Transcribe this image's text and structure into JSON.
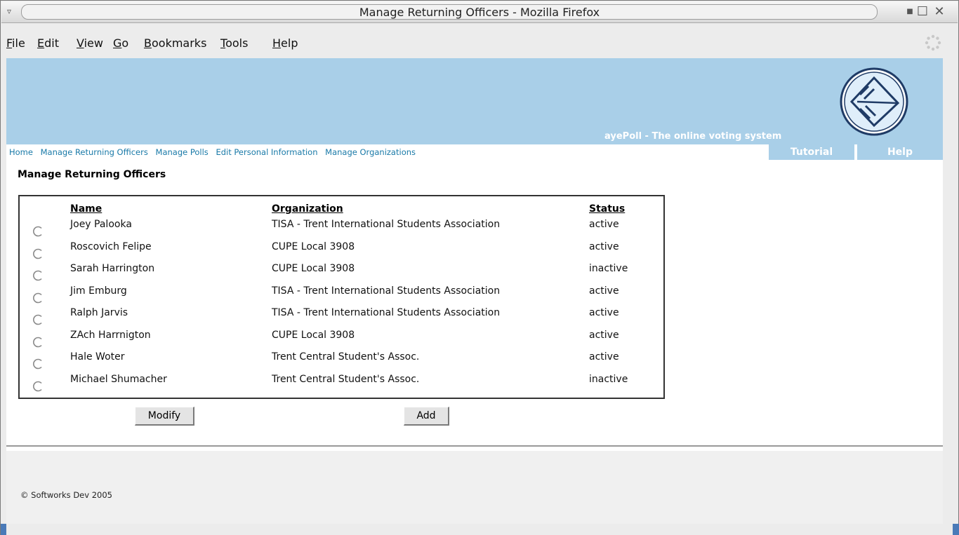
{
  "window": {
    "title": "Manage Returning Officers - Mozilla Firefox",
    "menu_glyph": "▿",
    "minimize_glyph": "■",
    "maximize_glyph": "☐",
    "close_glyph": "✕"
  },
  "menubar": {
    "items": [
      "File",
      "Edit",
      "View",
      "Go",
      "Bookmarks",
      "Tools",
      "Help"
    ]
  },
  "banner": {
    "tagline": "ayePoll - The online voting system",
    "logo_icon": "cupe-scfp-logo"
  },
  "nav": {
    "links": [
      "Home",
      "Manage Returning Officers",
      "Manage Polls",
      "Edit Personal Information",
      "Manage Organizations"
    ],
    "tabs": [
      "Tutorial",
      "Help"
    ]
  },
  "page": {
    "title": "Manage Returning Officers"
  },
  "table": {
    "headers": {
      "name": "Name",
      "organization": "Organization",
      "status": "Status"
    },
    "rows": [
      {
        "name": "Joey Palooka",
        "organization": "TISA - Trent International Students Association",
        "status": "active"
      },
      {
        "name": "Roscovich Felipe",
        "organization": "CUPE Local 3908",
        "status": "active"
      },
      {
        "name": "Sarah Harrington",
        "organization": "CUPE Local 3908",
        "status": "inactive"
      },
      {
        "name": "Jim Emburg",
        "organization": "TISA - Trent International Students Association",
        "status": "active"
      },
      {
        "name": "Ralph Jarvis",
        "organization": "TISA - Trent International Students Association",
        "status": "active"
      },
      {
        "name": "ZAch Harrnigton",
        "organization": "CUPE Local 3908",
        "status": "active"
      },
      {
        "name": "Hale Woter",
        "organization": "Trent Central Student's Assoc.",
        "status": "active"
      },
      {
        "name": "Michael Shumacher",
        "organization": "Trent Central Student's Assoc.",
        "status": "inactive"
      }
    ]
  },
  "actions": {
    "modify_label": "Modify",
    "add_label": "Add"
  },
  "footer": {
    "copyright": "© Softworks Dev 2005"
  },
  "colors": {
    "banner": "#a9cfe8",
    "nav_link": "#1a7aa8",
    "tab_text": "#ffffff"
  }
}
